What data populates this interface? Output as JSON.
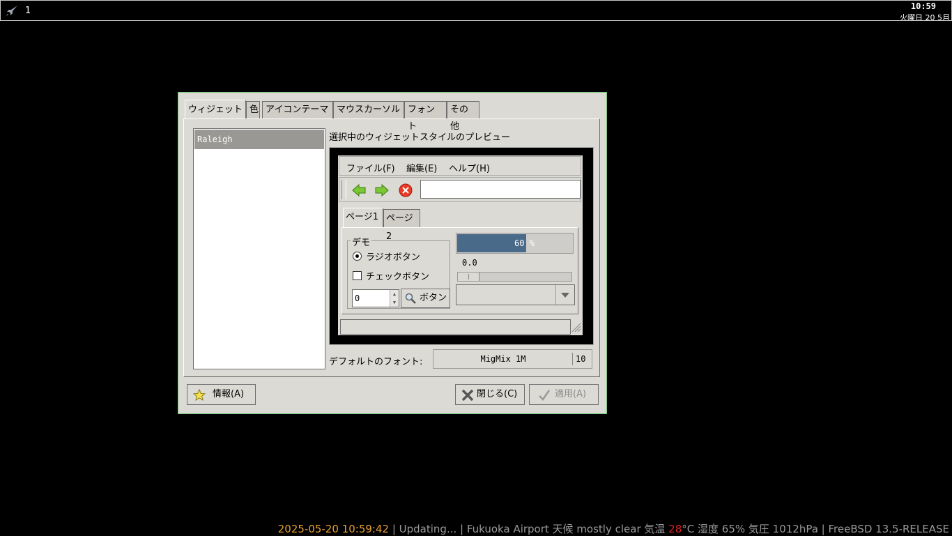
{
  "topbar": {
    "workspace": "1",
    "clock": "10:59",
    "date": "火曜日 20 5月"
  },
  "dialog": {
    "tabs": [
      "ウィジェット",
      "色",
      "アイコンテーマ",
      "マウスカーソル",
      "フォント",
      "その他"
    ],
    "active_tab": "ウィジェット",
    "theme_list": [
      "Raleigh"
    ],
    "preview_label": "選択中のウィジェットスタイルのプレビュー",
    "preview": {
      "menu": [
        "ファイル(F)",
        "編集(E)",
        "ヘルプ(H)"
      ],
      "menu_mnemonics": [
        "F",
        "E",
        "H"
      ],
      "tabs": [
        "ページ1",
        "ページ2"
      ],
      "frame_label": "デモ",
      "radio_label": "ラジオボタン",
      "check_label": "チェックボタン",
      "spin_value": "0",
      "button_label": "ボタン",
      "progress_text": "60 %",
      "progress_fraction": 0.6,
      "scale_value": "0.0"
    },
    "font_label": "デフォルトのフォント:",
    "font_name": "MigMix 1M",
    "font_size": "10",
    "buttons": {
      "about": "情報(A)",
      "close": "閉じる(C)",
      "apply": "適用(A)"
    }
  },
  "statusbar": {
    "datetime": "2025-05-20 10:59:42",
    "updating": " | Updating... | Fukuoka Airport 天候  mostly clear  気温 ",
    "temp": "28",
    "rest": "°C 湿度 65% 気圧 1012hPa | FreeBSD 13.5-RELEASE"
  },
  "colors": {
    "accent_border": "#7ec87e",
    "progress_fill": "#4a6a8a",
    "status_date": "#e8a030",
    "status_temp": "#e02020"
  }
}
